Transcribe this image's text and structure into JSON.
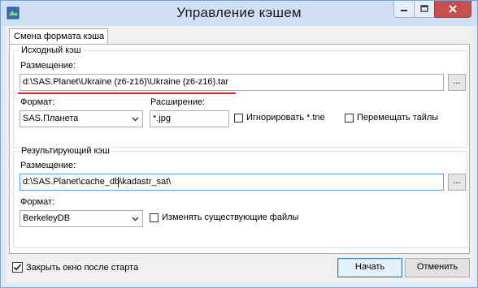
{
  "window": {
    "title": "Управление кэшем"
  },
  "tabs": [
    {
      "label": "Смена формата кэша"
    }
  ],
  "source": {
    "group_title": "Исходный кэш",
    "location_label": "Размещение:",
    "location_value": "d:\\SAS.Planet\\Ukraine (z6-z16)\\Ukraine (z6-z16).tar",
    "browse_label": "...",
    "format_label": "Формат:",
    "format_value": "SAS.Планета",
    "extension_label": "Расширение:",
    "extension_value": "*.jpg",
    "ignore_label": "Игнорировать *.tne",
    "move_label": "Перемещать тайлы"
  },
  "result": {
    "group_title": "Результирующий кэш",
    "location_label": "Размещение:",
    "location_value": "d:\\SAS.Planet\\cache_db\\kadastr_sat\\",
    "browse_label": "...",
    "format_label": "Формат:",
    "format_value": "BerkeleyDB",
    "overwrite_label": "Изменять существующие файлы"
  },
  "footer": {
    "close_after_start_label": "Закрыть окно после старта",
    "close_after_start_checked": true,
    "start_label": "Начать",
    "cancel_label": "Отменить"
  },
  "colors": {
    "accent_underline": "#e0242a",
    "close_button": "#c7504c",
    "frame": "#cfe0f6"
  }
}
